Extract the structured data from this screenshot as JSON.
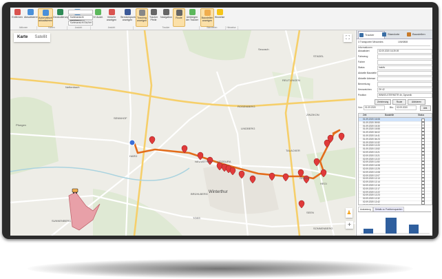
{
  "ribbon": {
    "buttons": [
      {
        "label": "Entfernen",
        "name": "entfernen-button",
        "color": "#d9534f"
      },
      {
        "label": "Aktualisieren",
        "name": "aktualisieren-button",
        "color": "#4a90d9"
      },
      {
        "label": "Automatisch aktualisieren",
        "name": "auto-aktualisieren-button",
        "color": "#4a90d9",
        "active": true
      },
      {
        "label": "Geokodierung",
        "name": "geokodierung-button",
        "color": "#2e8b57"
      },
      {
        "label": "Neue Kartenansicht",
        "name": "neue-kartenansicht-button",
        "color": "#5a9bd5"
      },
      {
        "label": "GV Ausbl.",
        "name": "gv-ausblenden-button",
        "color": "#5cb85c"
      },
      {
        "label": "Verkehr anzeigen",
        "name": "verkehr-anzeigen-button",
        "color": "#d9534f"
      },
      {
        "label": "Streckenpunkte anzeigen",
        "name": "streckenpunkte-anzeigen-button",
        "color": "#3b5998"
      },
      {
        "label": "Tracking anzeigen",
        "name": "tracking-anzeigen-button",
        "color": "#888",
        "active": true
      },
      {
        "label": "Tracker Pfeile",
        "name": "tracker-pfeile-button",
        "color": "#666"
      },
      {
        "label": "Navigation",
        "name": "navigation-button",
        "color": "#666"
      },
      {
        "label": "Route",
        "name": "route-button",
        "color": "#666",
        "active": true
      },
      {
        "label": "Umbiegen der Tracker",
        "name": "umbiegen-tracker-button",
        "color": "#5cb85c"
      },
      {
        "label": "Baustellen anzeigen",
        "name": "baustellen-anzeigen-button",
        "color": "#f0ad4e",
        "active": true
      },
      {
        "label": "Hinweise",
        "name": "hinweise-button",
        "color": "#f5c518"
      }
    ],
    "dropdowns": {
      "view_select": "",
      "view_saved": "Kartenansicht speichern",
      "view_delete": "Kartenansicht löschen"
    },
    "groups": [
      "Aktionen",
      "Karten",
      "Ansicht",
      "Ansicht",
      "Tracker",
      "Baustellen",
      "Hinweise"
    ]
  },
  "map": {
    "tabs": {
      "karte": "Karte",
      "satellit": "Satellit"
    },
    "labels": {
      "city": "Winterthur",
      "vitodura": "VITODURA",
      "lindberg": "LINDBERG",
      "talacker": "TALACKER",
      "hegi": "HEGI",
      "seen": "SEEN",
      "grüze": "GRÜZE",
      "neuwiesen": "NEUWIESEN",
      "brühlberg": "BRÜHLBERG",
      "töss": "TÖSS",
      "rosenberg": "ROSENBERG",
      "hard": "HARD",
      "pfungen": "Pfungen",
      "neftenbach": "Neftenbach",
      "sennhof": "SENNHOF",
      "reutlingen": "REUTLINGEN",
      "stadel": "STADEL",
      "sunnenberg": "SUNNENBERG",
      "seuzach": "Seuzach",
      "guggenbühl": "GUGGENBÜHL",
      "dättnau": "Dättnau",
      "zinzikon": "ZINZIKON",
      "oberwinterthur": "OBERWINTERTHUR",
      "sonnenberg": "SONNENBERG"
    },
    "icons": {
      "fullscreen": "⛶",
      "pegman": "♟",
      "zoom_in": "+"
    }
  },
  "panel": {
    "tabs": [
      {
        "label": "Tracker",
        "color": "#3a6ea5"
      },
      {
        "label": "Standorte",
        "color": "#3a6ea5"
      },
      {
        "label": "Baustellen",
        "color": "#c77a2a"
      }
    ],
    "count_label": "3 Transporter Meccedes",
    "count_value": "105/0808",
    "section_info": "Informationen",
    "fields": [
      {
        "label": "Aktualisiert",
        "value": "02.09.2020 16:39:09"
      },
      {
        "label": "Fahrzeug",
        "value": ""
      },
      {
        "label": "Fahrer",
        "value": ""
      },
      {
        "label": "Status",
        "value": "Inaktiv"
      },
      {
        "label": "Aktuelle Baustelle",
        "value": ""
      },
      {
        "label": "Aktuelle Adresse",
        "value": ""
      },
      {
        "label": "Bemerkung",
        "value": ""
      },
      {
        "label": "Kennzeichen",
        "value": "ZH 42"
      },
      {
        "label": "Position",
        "value": "WINKELSTERNSTR 4b, Dynamik"
      }
    ],
    "buttons": {
      "zentrierung": "Zentrierung",
      "route": "Route",
      "aktivieren": "Aktivieren"
    },
    "date_from_label": "Von:",
    "date_from": "01.09.2020",
    "date_to_label": "Bis:",
    "date_to": "02.09.2020",
    "apply": "Akti.",
    "grid_headers": {
      "zeit": "Zeit",
      "baustelle": "Baustelle",
      "status": "Status"
    },
    "rows": [
      "01.09.2020 16:08",
      "01.09.2020 09:50",
      "01.09.2020 15:30",
      "01.09.2020 15:55",
      "01.09.2020 04:02",
      "01.09.2020 14:41",
      "01.09.2020 04:23",
      "01.09.2020 10:32",
      "01.09.2020 12:20",
      "01.09.2020 13:52",
      "02.09.2020 13:21",
      "02.09.2020 13:21",
      "02.09.2020 12:22",
      "02.09.2020 11:50",
      "02.09.2020 14:08",
      "02.09.2020 12:25",
      "02.09.2020 12:08",
      "02.09.2020 12:07",
      "02.09.2020 12:13",
      "02.09.2020 12:14",
      "02.09.2020 12:16",
      "02.09.2020 12:17",
      "02.09.2020 12:22",
      "02.09.2020 12:23",
      "02.09.2020 12:32",
      "02.09.2020 12:42",
      "02.09.2020 12:37"
    ],
    "bottom_tabs": {
      "auslastung": "Auslastung",
      "details": "Details zu Positionsquanten"
    }
  },
  "colors": {
    "route": "#e36c1a",
    "marker": "#e03a3a",
    "area": "#e8a0a8",
    "accent": "#f0ad4e"
  }
}
